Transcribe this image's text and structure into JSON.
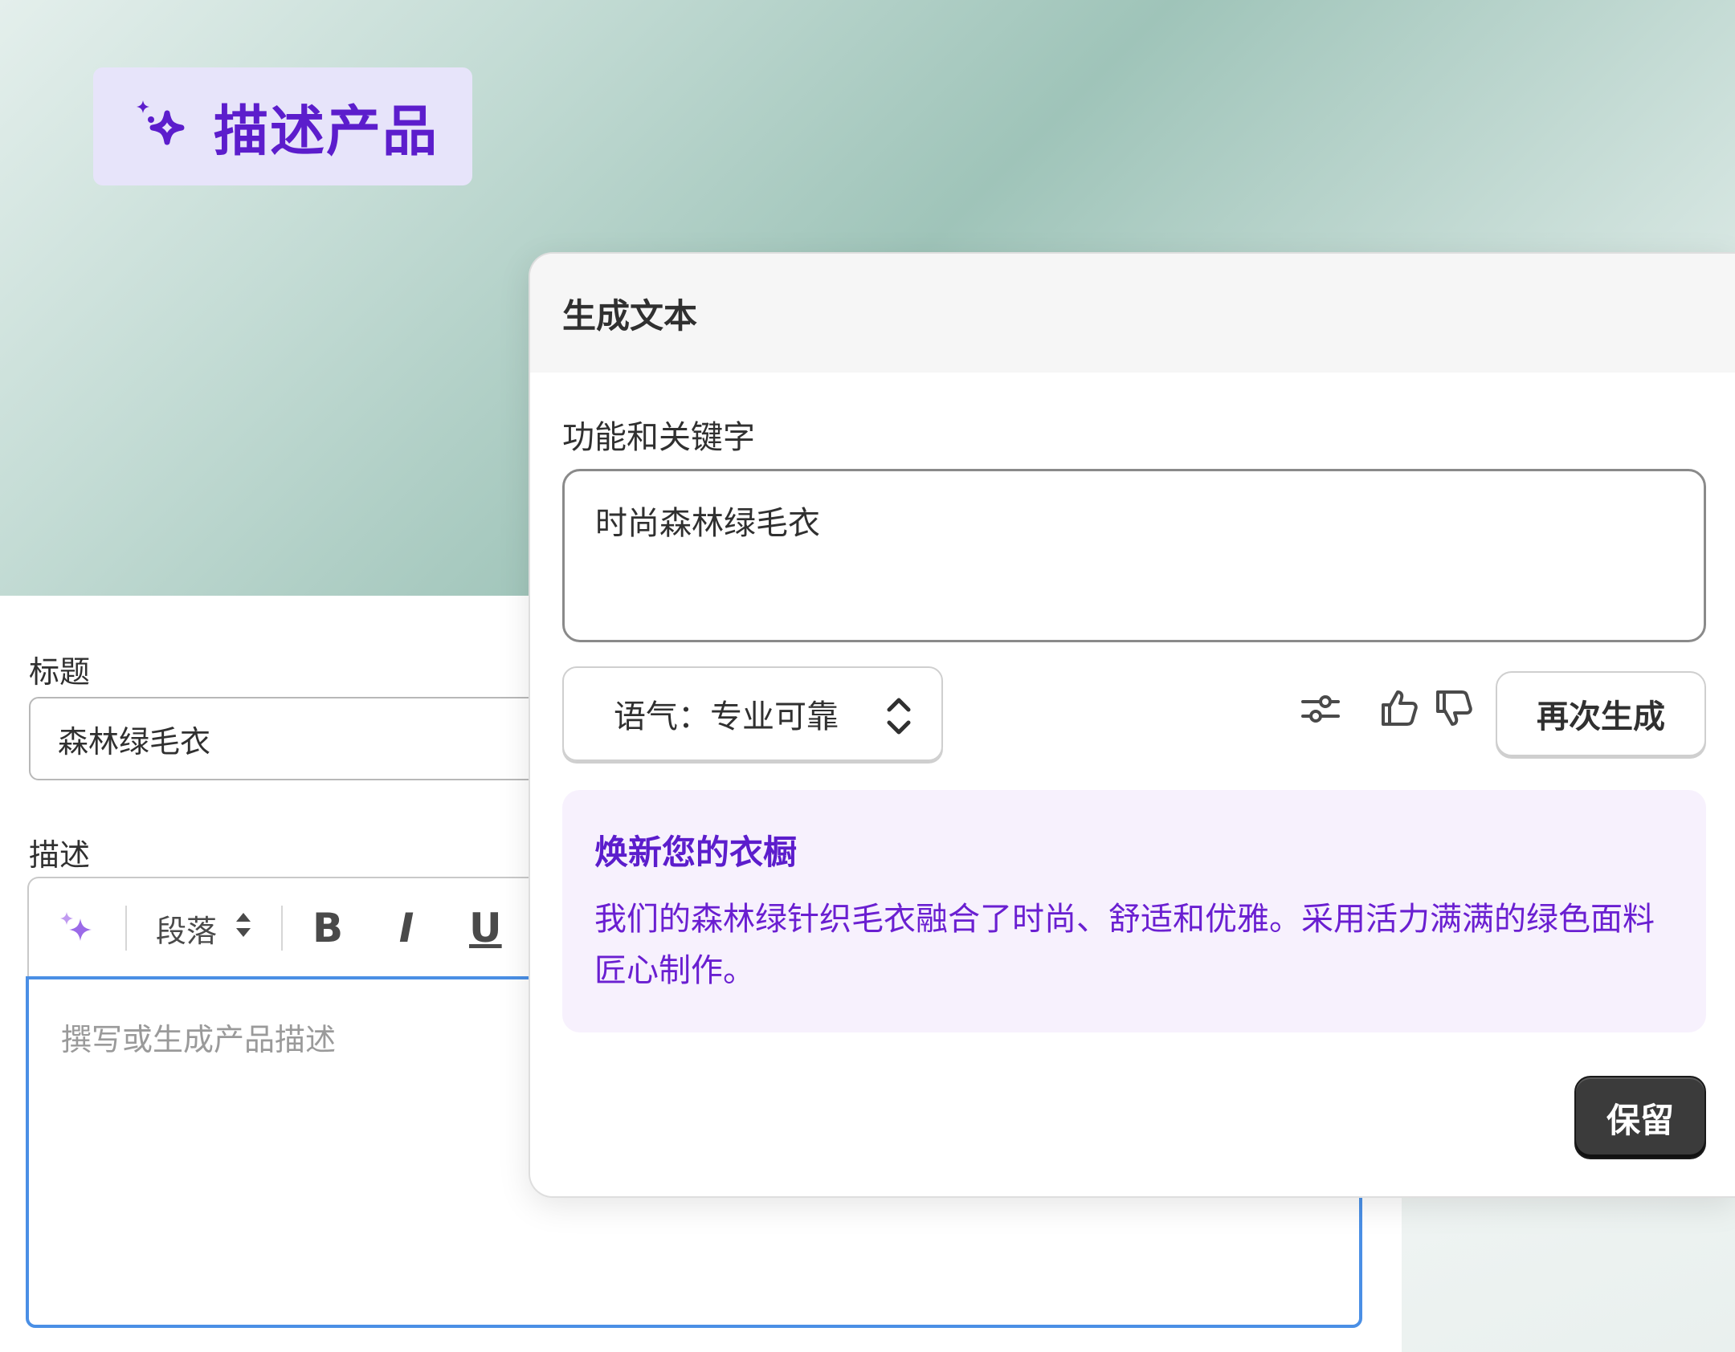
{
  "badge": {
    "label": "描述产品",
    "icon": "sparkle-icon",
    "color": "#5c1dcc"
  },
  "editor": {
    "title_label": "标题",
    "title_value": "森林绿毛衣",
    "description_label": "描述",
    "toolbar": {
      "ai_icon": "sparkle-icon",
      "paragraph_label": "段落",
      "bold": "B",
      "italic": "I",
      "underline": "U"
    },
    "description_placeholder": "撰写或生成产品描述"
  },
  "popover": {
    "header": "生成文本",
    "keywords_label": "功能和关键字",
    "keywords_value": "时尚森林绿毛衣",
    "tone_select": "语气：专业可靠",
    "regenerate_button": "再次生成",
    "result": {
      "title": "焕新您的衣橱",
      "body": "我们的森林绿针织毛衣融合了时尚、舒适和优雅。采用活力满满的绿色面料匠心制作。"
    },
    "keep_button": "保留",
    "accent_color": "#6a1fd1"
  }
}
